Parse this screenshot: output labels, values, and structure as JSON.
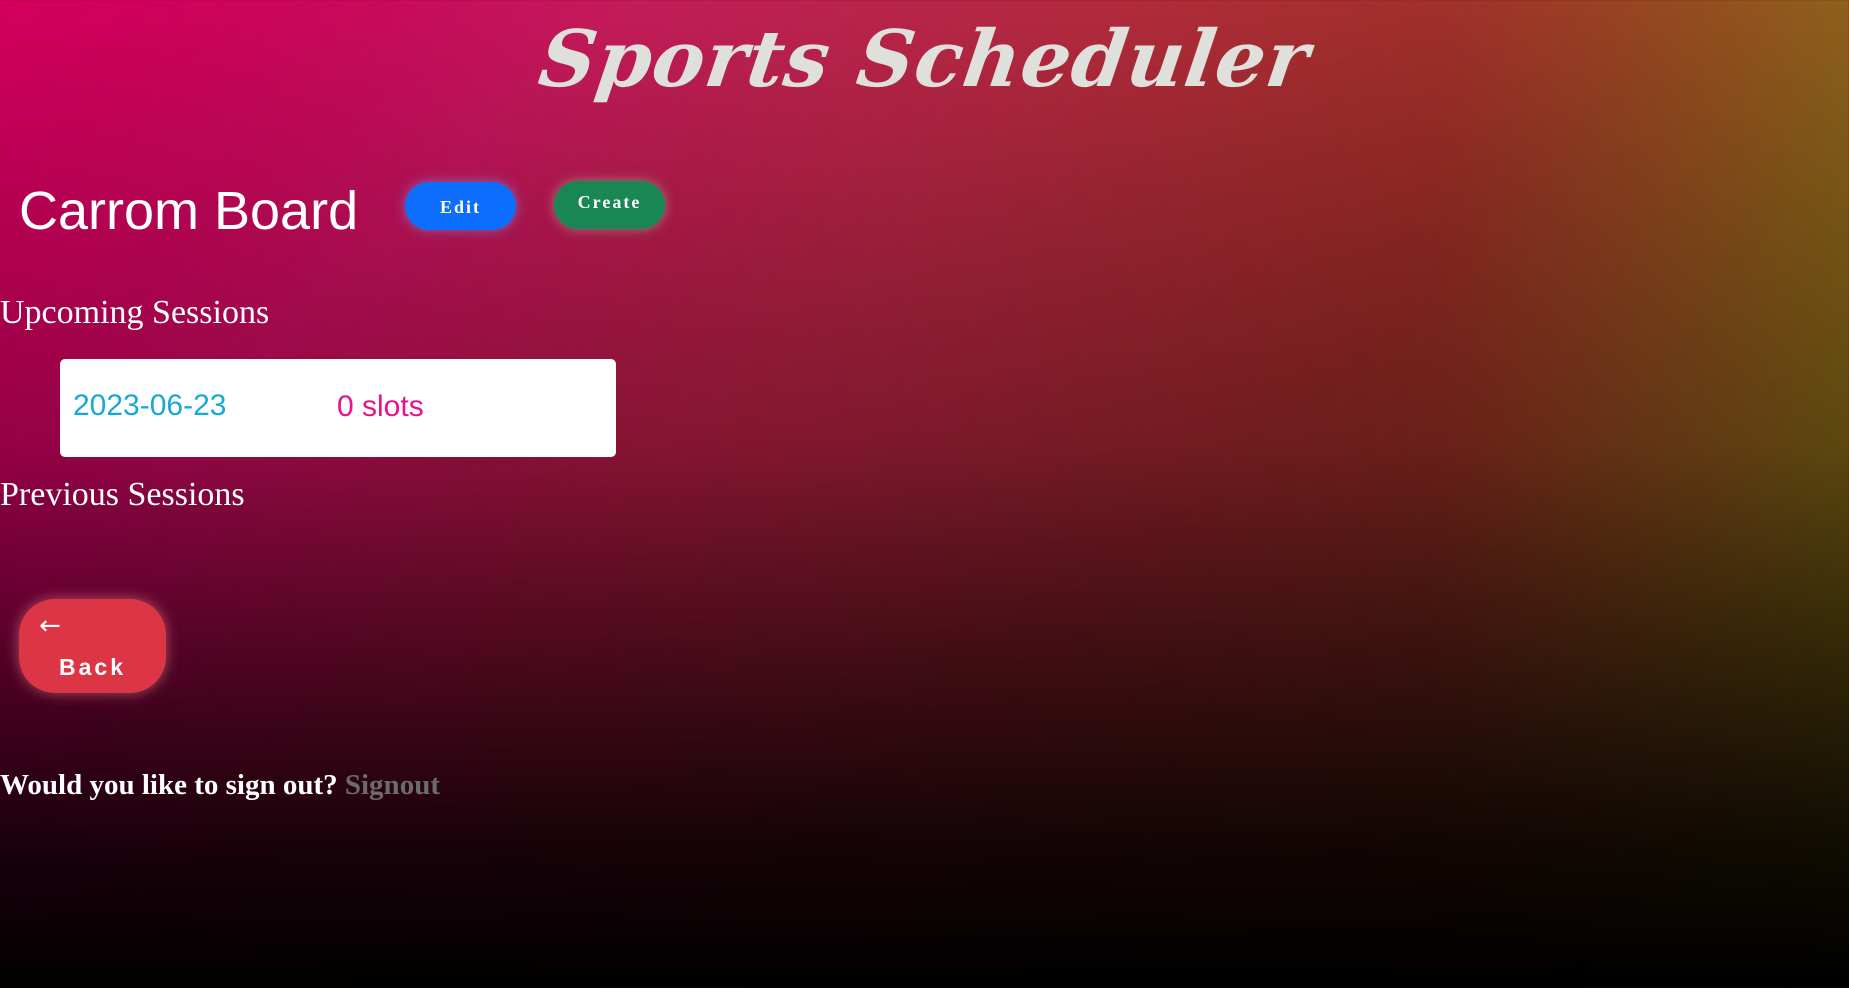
{
  "app": {
    "title": "Sports Scheduler"
  },
  "sport": {
    "name": "Carrom Board",
    "edit_label": "Edit",
    "create_label": "Create"
  },
  "upcoming": {
    "heading": "Upcoming Sessions",
    "sessions": [
      {
        "date": "2023-06-23",
        "slots": "0 slots"
      }
    ]
  },
  "previous": {
    "heading": "Previous Sessions",
    "sessions": []
  },
  "back": {
    "icon": "arrow-left-icon",
    "label": "Back"
  },
  "signout": {
    "prompt": "Would you like to sign out?",
    "link_label": "Signout"
  },
  "colors": {
    "edit": "#0d6efd",
    "create": "#198754",
    "back": "#dc3545",
    "date": "#17a9d6",
    "slots": "#e6118f"
  }
}
